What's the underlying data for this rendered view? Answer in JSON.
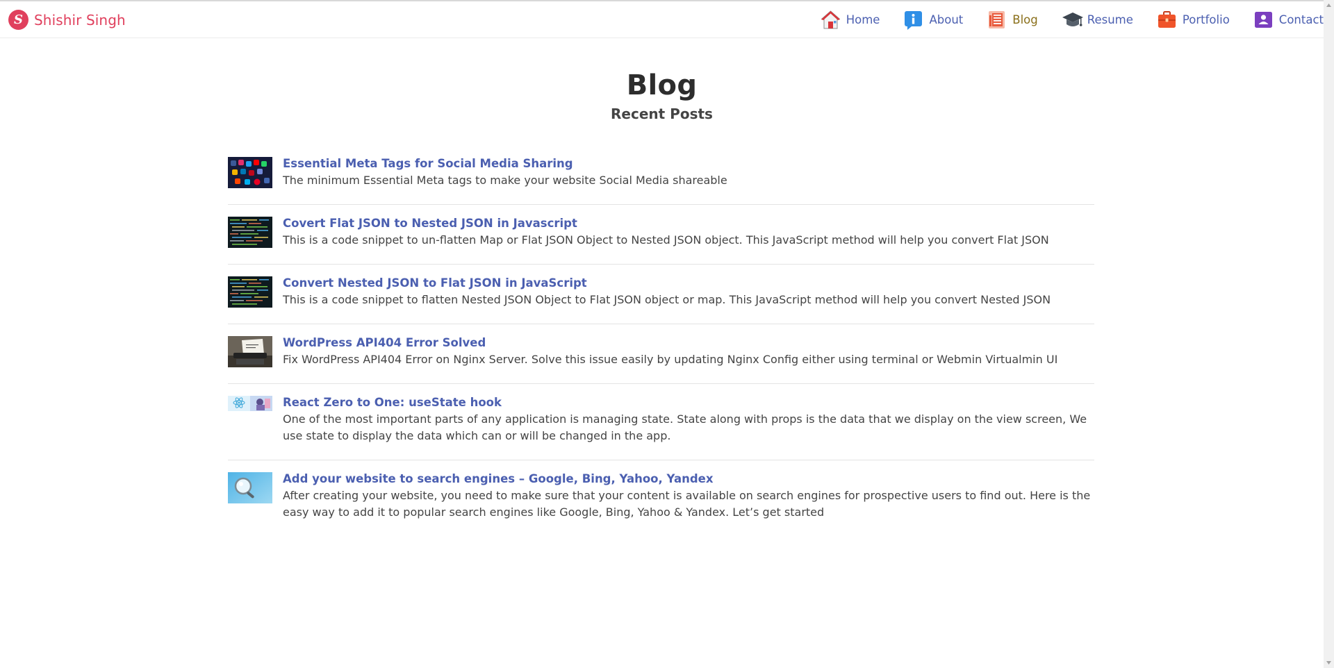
{
  "brand": {
    "name": "Shishir Singh",
    "logo_letter": "S"
  },
  "nav": {
    "items": [
      {
        "label": "Home",
        "icon": "house-icon"
      },
      {
        "label": "About",
        "icon": "info-icon"
      },
      {
        "label": "Blog",
        "icon": "newspaper-icon",
        "active": true
      },
      {
        "label": "Resume",
        "icon": "graduation-cap-icon"
      },
      {
        "label": "Portfolio",
        "icon": "briefcase-icon"
      },
      {
        "label": "Contact",
        "icon": "contact-card-icon"
      }
    ]
  },
  "page": {
    "title": "Blog",
    "subtitle": "Recent Posts"
  },
  "posts": [
    {
      "title": "Essential Meta Tags for Social Media Sharing",
      "description": "The minimum Essential Meta tags to make your website Social Media shareable",
      "thumbnail": "social-apps-thumbnail"
    },
    {
      "title": "Covert Flat JSON to Nested JSON in Javascript",
      "description": "This is a code snippet to un-flatten Map or Flat JSON Object to Nested JSON object. This JavaScript method will help you convert Flat JSON",
      "thumbnail": "code-thumbnail"
    },
    {
      "title": "Convert Nested JSON to Flat JSON in JavaScript",
      "description": "This is a code snippet to flatten Nested JSON Object to Flat JSON object or map. This JavaScript method will help you convert Nested JSON",
      "thumbnail": "code-thumbnail"
    },
    {
      "title": "WordPress API404 Error Solved",
      "description": "Fix WordPress API404 Error on Nginx Server. Solve this issue easily by updating Nginx Config either using terminal or Webmin Virtualmin UI",
      "thumbnail": "typewriter-thumbnail"
    },
    {
      "title": "React Zero to One: useState hook",
      "description": "One of the most important parts of any application is managing state. State along with props is the data that we display on the view screen, We use state to display the data which can or will be changed in the app.",
      "thumbnail": "react-thumbnail"
    },
    {
      "title": "Add your website to search engines – Google, Bing, Yahoo, Yandex",
      "description": "After creating your website, you need to make sure that your content is available on search engines for prospective users to find out. Here is the easy way to add it to popular search engines like Google, Bing, Yahoo & Yandex. Let’s get started",
      "thumbnail": "magnifier-thumbnail"
    }
  ],
  "colors": {
    "brand": "#e0405d",
    "link": "#4b5fb0",
    "active_nav": "#8a6f1a"
  }
}
